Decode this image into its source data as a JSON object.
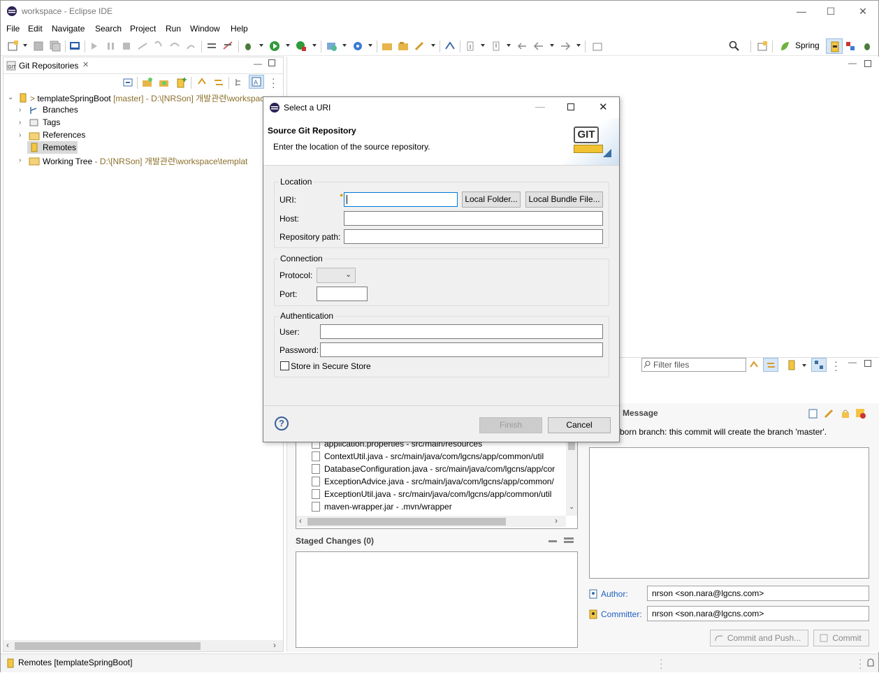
{
  "window": {
    "title": "workspace - Eclipse IDE",
    "minimize": "—",
    "maximize": "☐",
    "close": "✕"
  },
  "menu": {
    "file": "File",
    "edit": "Edit",
    "navigate": "Navigate",
    "search": "Search",
    "project": "Project",
    "run": "Run",
    "window": "Window",
    "help": "Help"
  },
  "toolbar": {
    "spring_label": "Spring"
  },
  "git_repos_view": {
    "tab_title": "Git Repositories",
    "repo": {
      "prefix": "> ",
      "name": "templateSpringBoot",
      "branch": "[master]",
      "path": "- D:\\[NRSon] 개발관련\\workspac"
    },
    "nodes": [
      "Branches",
      "Tags",
      "References",
      "Remotes"
    ],
    "working_tree": {
      "label": "Working Tree",
      "path": "- D:\\[NRSon] 개발관련\\workspace\\templat"
    }
  },
  "staging": {
    "filter_placeholder": "Filter files",
    "unstaged_files": [
      "application.properties - src/main/resources",
      "ContextUtil.java - src/main/java/com/lgcns/app/common/util",
      "DatabaseConfiguration.java - src/main/java/com/lgcns/app/cor",
      "ExceptionAdvice.java - src/main/java/com/lgcns/app/common/",
      "ExceptionUtil.java - src/main/java/com/lgcns/app/common/util",
      "maven-wrapper.jar - .mvn/wrapper"
    ],
    "staged_header": "Staged Changes (0)",
    "commit_message_header": "Message",
    "commit_note": "born branch: this commit will create the branch 'master'.",
    "author_label": "Author:",
    "author_value": "nrson <son.nara@lgcns.com>",
    "committer_label": "Committer:",
    "committer_value": "nrson <son.nara@lgcns.com>",
    "commit_push_button": "Commit and Push...",
    "commit_button": "Commit"
  },
  "status": {
    "text": "Remotes [templateSpringBoot]"
  },
  "dialog": {
    "title": "Select a URI",
    "heading": "Source Git Repository",
    "description": "Enter the location of the source repository.",
    "git_logo": "GIT",
    "location_group": "Location",
    "uri_label": "URI:",
    "uri_value": "",
    "local_folder_button": "Local Folder...",
    "local_bundle_button": "Local Bundle File...",
    "host_label": "Host:",
    "repo_path_label": "Repository path:",
    "connection_group": "Connection",
    "protocol_label": "Protocol:",
    "port_label": "Port:",
    "auth_group": "Authentication",
    "user_label": "User:",
    "password_label": "Password:",
    "secure_store_label": "Store in Secure Store",
    "secure_store_checked": false,
    "help": "?",
    "finish_button": "Finish",
    "cancel_button": "Cancel"
  },
  "colors": {
    "accent": "#0078d7",
    "branch_text": "#8b6f2b",
    "link_blue": "#1f5fbf"
  }
}
